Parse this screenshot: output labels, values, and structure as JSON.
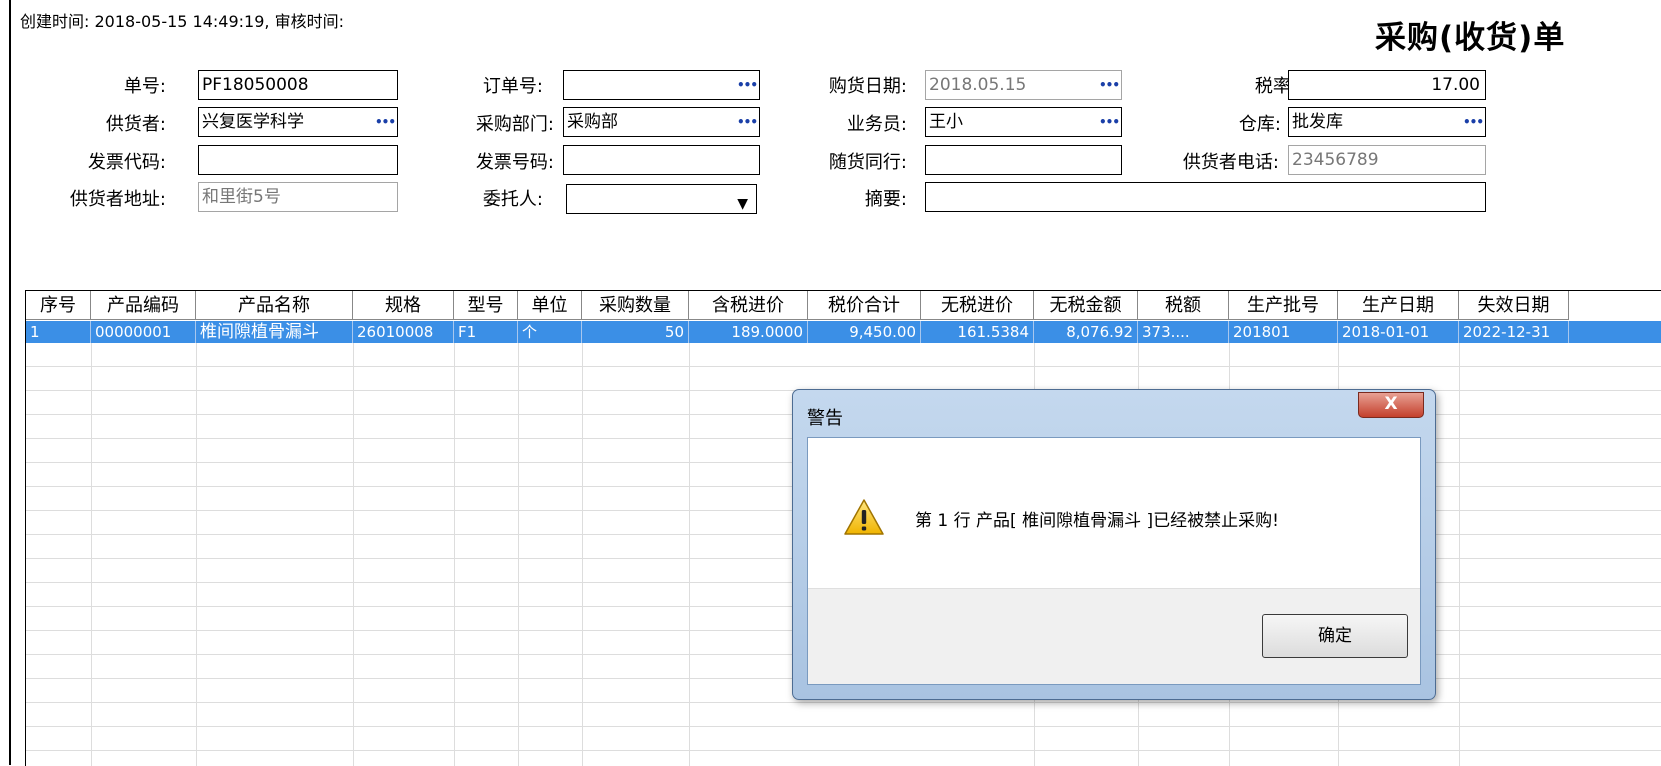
{
  "meta_text": "创建时间: 2018-05-15 14:49:19, 审核时间:",
  "title": "采购(收货)单",
  "form": {
    "order_no": {
      "label": "单号:",
      "value": "PF18050008"
    },
    "ref_order": {
      "label": "订单号:",
      "value": ""
    },
    "purchase_date": {
      "label": "购货日期:",
      "value": "2018.05.15"
    },
    "tax_rate": {
      "label": "税率:",
      "value": "17.00"
    },
    "supplier": {
      "label": "供货者:",
      "value": "兴复医学科学"
    },
    "dept": {
      "label": "采购部门:",
      "value": "采购部"
    },
    "salesman": {
      "label": "业务员:",
      "value": "王小"
    },
    "warehouse": {
      "label": "仓库:",
      "value": "批发库"
    },
    "invoice_code": {
      "label": "发票代码:",
      "value": ""
    },
    "invoice_no": {
      "label": "发票号码:",
      "value": ""
    },
    "companion": {
      "label": "随货同行:",
      "value": ""
    },
    "supplier_phone": {
      "label": "供货者电话:",
      "value": "23456789"
    },
    "supplier_addr": {
      "label": "供货者地址:",
      "value": "和里街5号"
    },
    "entrust": {
      "label": "委托人:",
      "value": ""
    },
    "summary": {
      "label": "摘要:",
      "value": ""
    }
  },
  "grid": {
    "headers": [
      "序号",
      "产品编码",
      "产品名称",
      "规格",
      "型号",
      "单位",
      "采购数量",
      "含税进价",
      "税价合计",
      "无税进价",
      "无税金额",
      "税额",
      "生产批号",
      "生产日期",
      "失效日期"
    ],
    "rows": [
      [
        "1",
        "00000001",
        "椎间隙植骨漏斗",
        "26010008",
        "F1",
        "个",
        "50",
        "189.0000",
        "9,450.00",
        "161.5384",
        "8,076.92",
        "373....",
        "201801",
        "2018-01-01",
        "2022-12-31"
      ]
    ]
  },
  "dialog": {
    "title": "警告",
    "close": "X",
    "message": "第 1 行 产品[ 椎间隙植骨漏斗 ]已经被禁止采购!",
    "ok": "确定"
  },
  "icons": {
    "ellipsis": "ellipsis-icon",
    "dropdown": "chevron-down-icon",
    "warning": "warning-icon"
  },
  "colors": {
    "selection": "#3b8fe6",
    "dialog_frame": "#b9d1ea",
    "close_button": "#c4402c"
  }
}
